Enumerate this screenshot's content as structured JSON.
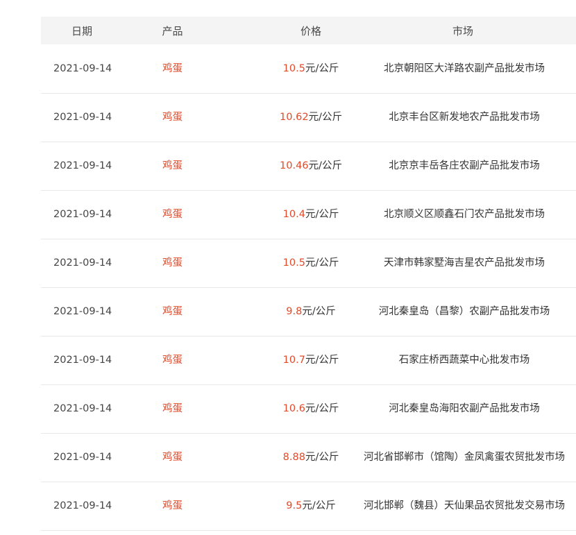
{
  "table": {
    "headers": {
      "date": "日期",
      "product": "产品",
      "price": "价格",
      "market": "市场"
    },
    "unit": "元/公斤",
    "rows": [
      {
        "date": "2021-09-14",
        "product": "鸡蛋",
        "price": "10.5",
        "market": "北京朝阳区大洋路农副产品批发市场"
      },
      {
        "date": "2021-09-14",
        "product": "鸡蛋",
        "price": "10.62",
        "market": "北京丰台区新发地农产品批发市场"
      },
      {
        "date": "2021-09-14",
        "product": "鸡蛋",
        "price": "10.46",
        "market": "北京京丰岳各庄农副产品批发市场"
      },
      {
        "date": "2021-09-14",
        "product": "鸡蛋",
        "price": "10.4",
        "market": "北京顺义区顺鑫石门农产品批发市场"
      },
      {
        "date": "2021-09-14",
        "product": "鸡蛋",
        "price": "10.5",
        "market": "天津市韩家墅海吉星农产品批发市场"
      },
      {
        "date": "2021-09-14",
        "product": "鸡蛋",
        "price": "9.8",
        "market": "河北秦皇岛（昌黎）农副产品批发市场"
      },
      {
        "date": "2021-09-14",
        "product": "鸡蛋",
        "price": "10.7",
        "market": "石家庄桥西蔬菜中心批发市场"
      },
      {
        "date": "2021-09-14",
        "product": "鸡蛋",
        "price": "10.6",
        "market": "河北秦皇岛海阳农副产品批发市场"
      },
      {
        "date": "2021-09-14",
        "product": "鸡蛋",
        "price": "8.88",
        "market": "河北省邯郸市（馆陶）金凤禽蛋农贸批发市场"
      },
      {
        "date": "2021-09-14",
        "product": "鸡蛋",
        "price": "9.5",
        "market": "河北邯郸（魏县）天仙果品农贸批发交易市场"
      }
    ]
  },
  "colors": {
    "accent": "#e04a2a",
    "header_bg": "#f4f4f4",
    "row_border": "#e8e8e8"
  }
}
